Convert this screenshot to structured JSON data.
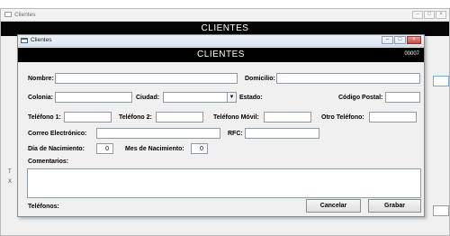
{
  "background_window": {
    "title": "Clientes",
    "banner": "CLIENTES",
    "controls": [
      "–",
      "□",
      "×"
    ]
  },
  "window": {
    "title": "Clientes",
    "controls": [
      "–",
      "□",
      "×"
    ],
    "banner_title": "CLIENTES",
    "record_code": "00007"
  },
  "form": {
    "nombre_label": "Nombre:",
    "domicilio_label": "Domicilio:",
    "colonia_label": "Colonia:",
    "ciudad_label": "Ciudad:",
    "estado_label": "Estado:",
    "codigo_postal_label": "Código Postal:",
    "telefono1_label": "Teléfono 1:",
    "telefono2_label": "Teléfono 2:",
    "telefono_movil_label": "Teléfono Móvil:",
    "otro_telefono_label": "Otro Teléfono:",
    "correo_label": "Correo Electrónico:",
    "rfc_label": "RFC:",
    "dia_nacimiento_label": "Día de Nacimiento:",
    "dia_nacimiento_value": "0",
    "mes_nacimiento_label": "Mes de Nacimiento:",
    "mes_nacimiento_value": "0",
    "comentarios_label": "Comentarios:",
    "telefonos_label": "Teléfonos:"
  },
  "buttons": {
    "cancelar": "Cancelar",
    "grabar": "Grabar"
  },
  "icons": {
    "dropdown": "chevron-down-icon",
    "app": "window-app-icon"
  }
}
